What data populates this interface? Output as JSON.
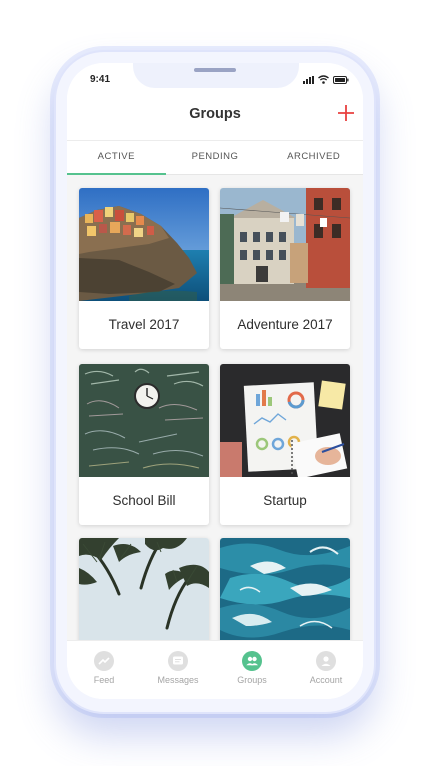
{
  "status_bar": {
    "time": "9:41"
  },
  "header": {
    "title": "Groups",
    "add_icon": "plus-icon",
    "accent_color": "#e8403f"
  },
  "tabs": [
    {
      "label": "ACTIVE",
      "selected": true
    },
    {
      "label": "PENDING",
      "selected": false
    },
    {
      "label": "ARCHIVED",
      "selected": false
    }
  ],
  "tab_accent_color": "#55c28e",
  "groups": [
    {
      "title": "Travel 2017",
      "image": "coastal-cliff-village-photo"
    },
    {
      "title": "Adventure 2017",
      "image": "old-town-street-photo"
    },
    {
      "title": "School Bill",
      "image": "chalkboard-clock-photo"
    },
    {
      "title": "Startup",
      "image": "desk-charts-notebook-photo"
    },
    {
      "title": "",
      "image": "palm-trees-sky-photo"
    },
    {
      "title": "",
      "image": "ocean-waves-photo"
    }
  ],
  "tab_bar": [
    {
      "label": "Feed",
      "icon": "trend-line-icon",
      "active": false
    },
    {
      "label": "Messages",
      "icon": "chat-bubble-icon",
      "active": false
    },
    {
      "label": "Groups",
      "icon": "people-icon",
      "active": true
    },
    {
      "label": "Account",
      "icon": "person-icon",
      "active": false
    }
  ]
}
